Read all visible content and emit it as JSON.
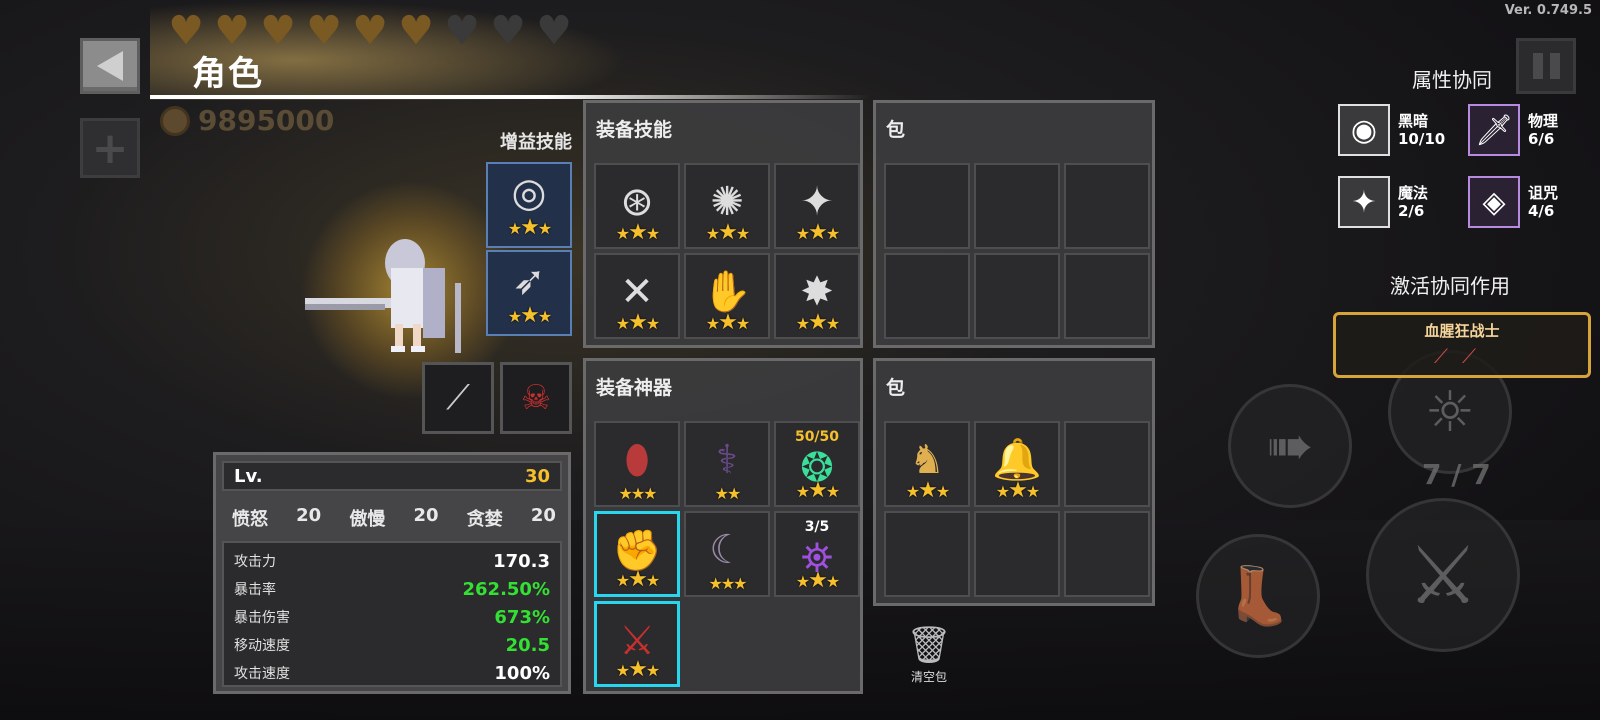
{
  "version": "Ver. 0.749.5",
  "header": {
    "title": "角色",
    "currency": "9895000"
  },
  "hearts": {
    "full": 6,
    "empty": 3
  },
  "buff_skills": {
    "title": "增益技能",
    "slots": [
      {
        "icon": "swirl-rune-icon",
        "stars": 3
      },
      {
        "icon": "bow-arrows-icon",
        "stars": 3
      }
    ]
  },
  "equip_skills": {
    "title": "装备技能",
    "slots": [
      {
        "icon": "rune-circle-icon",
        "stars": 3
      },
      {
        "icon": "vortex-icon",
        "stars": 3
      },
      {
        "icon": "shuriken-icon",
        "stars": 3
      },
      {
        "icon": "cross-blades-icon",
        "stars": 3
      },
      {
        "icon": "gauntlet-icon",
        "stars": 3
      },
      {
        "icon": "burst-target-icon",
        "stars": 3
      }
    ]
  },
  "bag_top": {
    "title": "包"
  },
  "equip_artifacts": {
    "title": "装备神器",
    "slots": [
      {
        "icon": "red-egg-icon",
        "stars": 3,
        "count": ""
      },
      {
        "icon": "dark-staff-icon",
        "stars": 2,
        "count": ""
      },
      {
        "icon": "green-spirit-icon",
        "stars": 3,
        "count": "50/50"
      },
      {
        "icon": "red-gauntlet-icon",
        "stars": 3,
        "count": ""
      },
      {
        "icon": "dark-scythe-icon",
        "stars": 3,
        "count": ""
      },
      {
        "icon": "purple-lantern-icon",
        "stars": 3,
        "count": "3/5"
      },
      {
        "icon": "crimson-sword-icon",
        "stars": 3,
        "count": ""
      }
    ]
  },
  "bag_bottom": {
    "title": "包",
    "slots": [
      {
        "icon": "golden-deer-icon",
        "stars": 3
      },
      {
        "icon": "golden-bell-icon",
        "stars": 3
      }
    ]
  },
  "character_slots": [
    "scythe-weapon-icon",
    "red-hood-skull-icon"
  ],
  "stats": {
    "lv_label": "Lv.",
    "lv": "30",
    "sins": [
      {
        "label": "愤怒",
        "value": "20"
      },
      {
        "label": "傲慢",
        "value": "20"
      },
      {
        "label": "贪婪",
        "value": "20"
      }
    ],
    "rows": [
      {
        "label": "攻击力",
        "value": "170.3",
        "color": "#ffffff"
      },
      {
        "label": "暴击率",
        "value": "262.50%",
        "color": "#33e033"
      },
      {
        "label": "暴击伤害",
        "value": "673%",
        "color": "#33e033"
      },
      {
        "label": "移动速度",
        "value": "20.5",
        "color": "#33e033"
      },
      {
        "label": "攻击速度",
        "value": "100%",
        "color": "#ffffff"
      }
    ]
  },
  "clear_bag": "清空包",
  "synergy": {
    "title": "属性协同",
    "items": [
      {
        "name": "黑暗",
        "count": "10/10",
        "icon": "dark-orb-icon"
      },
      {
        "name": "物理",
        "count": "6/6",
        "icon": "sword-icon"
      },
      {
        "name": "魔法",
        "count": "2/6",
        "icon": "star-diamond-icon"
      },
      {
        "name": "诅咒",
        "count": "4/6",
        "icon": "eye-icon"
      }
    ],
    "active_title": "激活协同作用",
    "active": {
      "name": "血腥狂战士"
    }
  },
  "controls": {
    "charge_count": "7 / 7"
  }
}
